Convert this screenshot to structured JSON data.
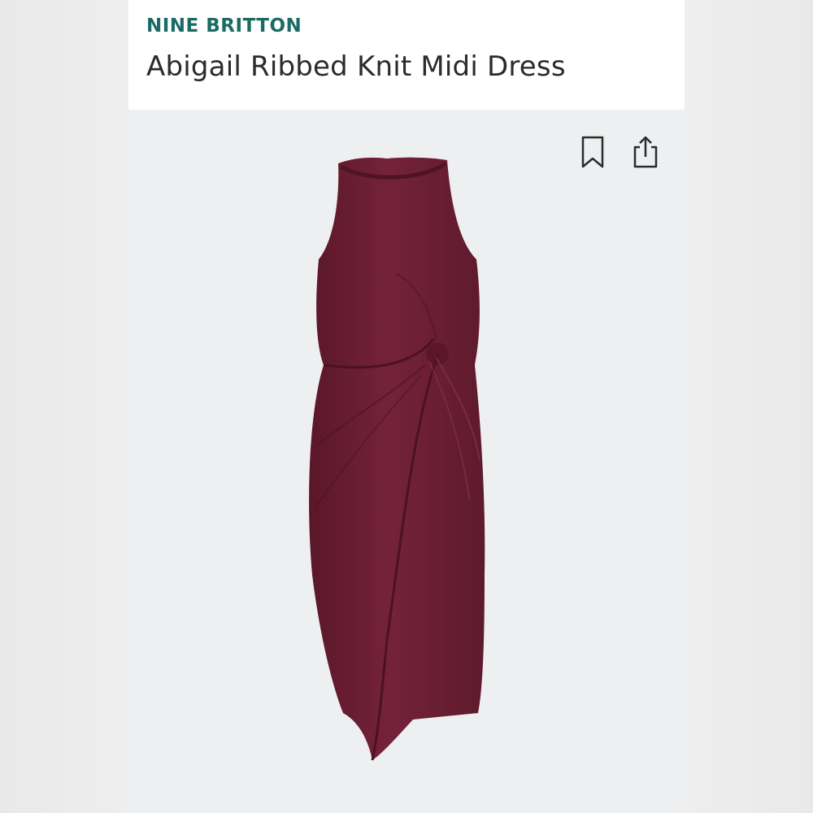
{
  "product": {
    "brand": "NINE BRITTON",
    "name": "Abigail Ribbed Knit Midi Dress"
  },
  "icons": {
    "save": "bookmark-icon",
    "share": "share-icon"
  },
  "colors": {
    "brand_text": "#1a6b64",
    "dress": "#6e1f35"
  }
}
